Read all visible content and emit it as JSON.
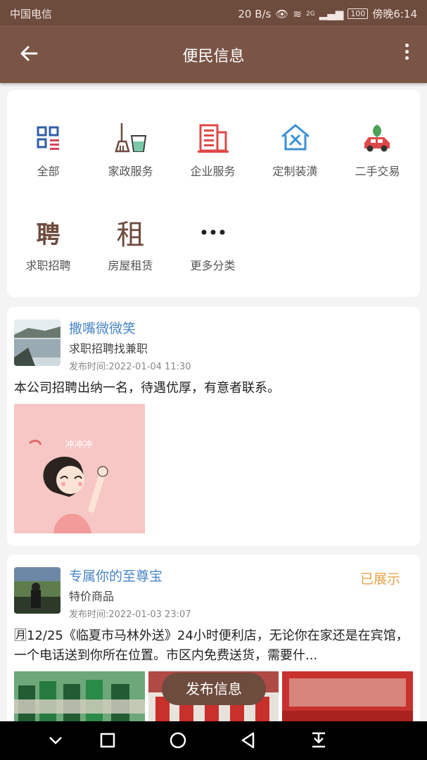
{
  "status_bar": {
    "carrier": "中国电信",
    "speed": "20 B/s",
    "network": "2G",
    "battery": "100",
    "time": "傍晚6:14"
  },
  "app_bar": {
    "title": "便民信息"
  },
  "categories": [
    {
      "label": "全部",
      "icon": "grid-list-icon"
    },
    {
      "label": "家政服务",
      "icon": "broom-bucket-icon"
    },
    {
      "label": "企业服务",
      "icon": "office-building-icon"
    },
    {
      "label": "定制装潢",
      "icon": "house-tools-icon"
    },
    {
      "label": "二手交易",
      "icon": "car-leaf-icon"
    },
    {
      "label": "求职招聘",
      "icon": "recruit-char-icon",
      "glyph": "聘"
    },
    {
      "label": "房屋租赁",
      "icon": "house-rent-char-icon",
      "glyph": "租"
    },
    {
      "label": "更多分类",
      "icon": "more-dots-icon"
    }
  ],
  "posts": [
    {
      "username": "撒嘴微微笑",
      "category": "求职招聘找兼职",
      "time": "发布时间:2022-01-04 11:30",
      "content": "本公司招聘出纳一名，待遇优厚，有意者联系。",
      "image_caption": "冲冲冲",
      "status": ""
    },
    {
      "username": "专属你的至尊宝",
      "category": "特价商品",
      "time": "发布时间:2022-01-03 23:07",
      "content": "🈷12/25《临夏市马林外送》24小时便利店，无论你在家还是在宾馆，一个电话送到你所在位置。市区内免费送货，需要什...",
      "status": "已展示"
    }
  ],
  "fab": {
    "label": "发布信息"
  },
  "colors": {
    "primary": "#7a5546",
    "status_bar": "#6d4b3d",
    "link": "#4a86c6",
    "status_tag": "#e9a24a"
  }
}
